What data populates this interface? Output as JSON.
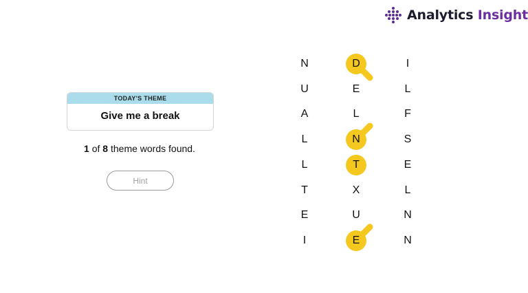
{
  "logo": {
    "text_main": "Analytics",
    "text_accent": "Insight",
    "icon": "dot-grid-logo-icon",
    "color_main": "#1c1c2e",
    "color_accent": "#6a2fa0"
  },
  "theme": {
    "heading": "TODAY'S THEME",
    "title": "Give me a break",
    "heading_bg": "#aadcec"
  },
  "progress": {
    "found": "1",
    "of_text": " of ",
    "total": "8",
    "suffix": " theme words found."
  },
  "hint": {
    "label": "Hint"
  },
  "board": {
    "highlight_color": "#f4c81e",
    "columns": [
      [
        "N",
        "U",
        "A",
        "L",
        "L",
        "T",
        "E",
        "I"
      ],
      [
        "D",
        "E",
        "L",
        "N",
        "T",
        "X",
        "U",
        "E"
      ],
      [
        "I",
        "L",
        "F",
        "S",
        "E",
        "L",
        "N",
        "N"
      ]
    ],
    "selected": [
      [
        1,
        0
      ],
      [
        1,
        3
      ],
      [
        1,
        4
      ],
      [
        1,
        7
      ]
    ]
  }
}
